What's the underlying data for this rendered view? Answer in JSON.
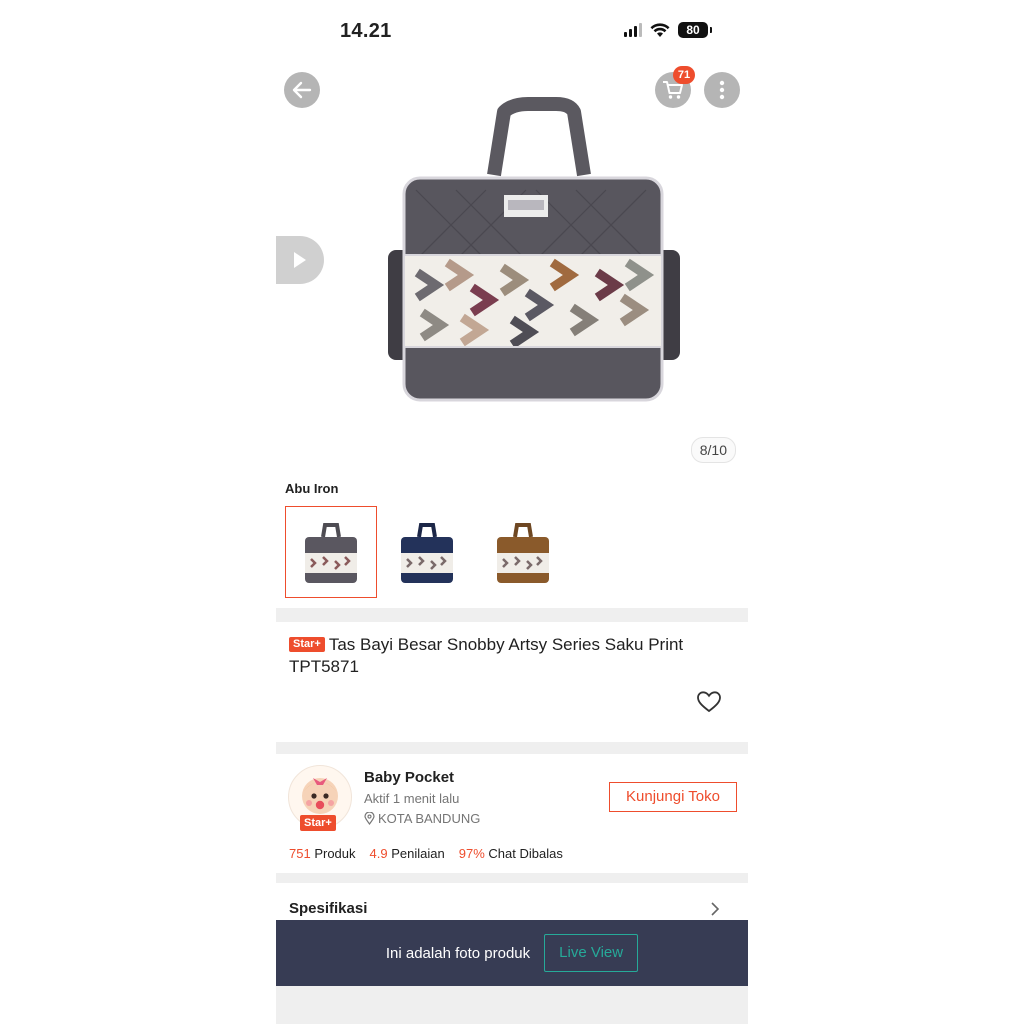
{
  "status_bar": {
    "time": "14.21",
    "battery": "80"
  },
  "header": {
    "cart_count": "71"
  },
  "gallery": {
    "counter": "8/10"
  },
  "variants": {
    "label": "Abu Iron",
    "items": [
      {
        "color": "#5a5760",
        "selected": true
      },
      {
        "color": "#23325a",
        "selected": false
      },
      {
        "color": "#8a5a2b",
        "selected": false
      }
    ]
  },
  "product": {
    "badge": "Star+",
    "title": "Tas Bayi Besar Snobby Artsy Series Saku Print TPT5871"
  },
  "shop": {
    "name": "Baby Pocket",
    "active": "Aktif 1 menit lalu",
    "location": "KOTA BANDUNG",
    "badge": "Star+",
    "visit_label": "Kunjungi Toko",
    "stats": {
      "products_value": "751",
      "products_label": "Produk",
      "rating_value": "4.9",
      "rating_label": "Penilaian",
      "chat_value": "97%",
      "chat_label": "Chat Dibalas"
    }
  },
  "spec": {
    "label": "Spesifikasi"
  },
  "live_bar": {
    "text": "Ini adalah foto produk",
    "button_label": "Live View"
  },
  "colors": {
    "accent": "#ee4d2d",
    "live_green": "#26aa99",
    "bar_bg": "#373c54"
  }
}
